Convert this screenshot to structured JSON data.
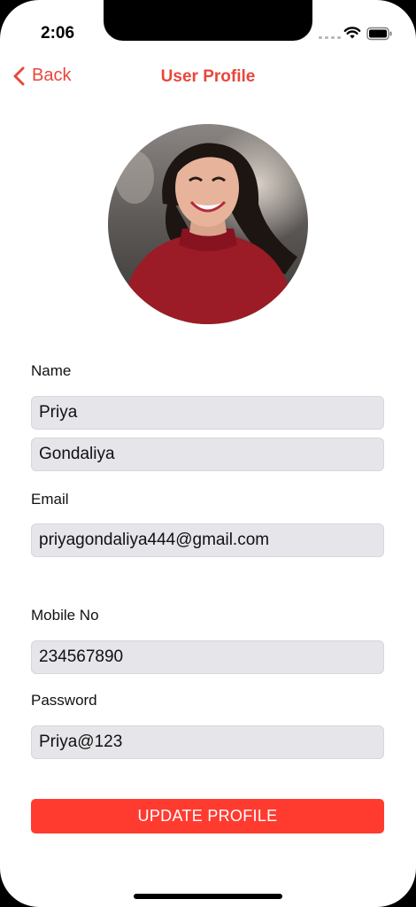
{
  "status_bar": {
    "time": "2:06"
  },
  "nav": {
    "back_label": "Back",
    "title": "User Profile"
  },
  "colors": {
    "accent": "#e8473a",
    "button": "#ff3b30",
    "field_bg": "#e5e5ea"
  },
  "form": {
    "name_label": "Name",
    "first_name": "Priya",
    "last_name": "Gondaliya",
    "email_label": "Email",
    "email": "priyagondaliya444@gmail.com",
    "mobile_label": "Mobile No",
    "mobile": "234567890",
    "password_label": "Password",
    "password": "Priya@123"
  },
  "actions": {
    "update_label": "UPDATE PROFILE"
  }
}
